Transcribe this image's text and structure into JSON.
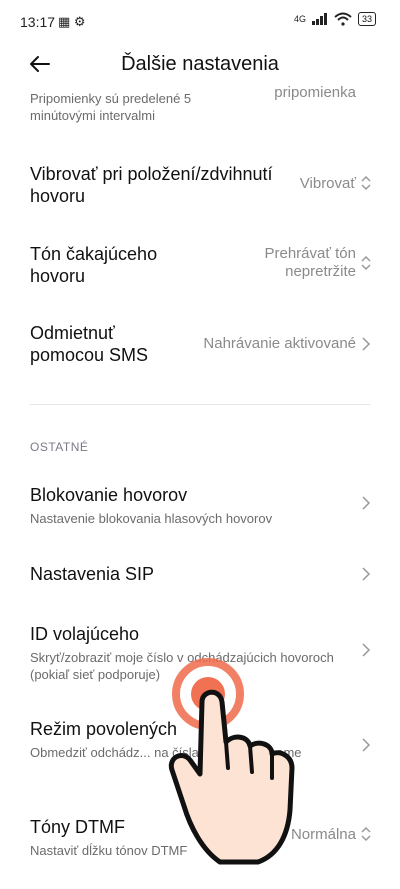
{
  "status_bar": {
    "time": "13:17",
    "battery": "33",
    "network": "4G"
  },
  "header": {
    "title": "Ďalšie nastavenia",
    "back_icon": "back-arrow-icon"
  },
  "top_partial": {
    "subtitle": "Pripomienky sú predelené 5 minútovými intervalmi",
    "value": "pripomienka"
  },
  "rows": [
    {
      "title": "Vibrovať pri položení/zdvihnutí hovoru",
      "value": "Vibrovať",
      "chevron": "up-down-chevron-icon"
    },
    {
      "title": "Tón čakajúceho hovoru",
      "value": "Prehrávať tón nepretržite",
      "chevron": "up-down-chevron-icon"
    },
    {
      "title": "Odmietnuť pomocou SMS",
      "value": "Nahrávanie aktivované",
      "chevron": "chevron-right-icon"
    }
  ],
  "section": {
    "label": "OSTATNÉ"
  },
  "other_rows": [
    {
      "title": "Blokovanie hovorov",
      "subtitle": "Nastavenie blokovania hlasových hovorov",
      "chevron": "chevron-right-icon"
    },
    {
      "title": "Nastavenia SIP",
      "chevron": "chevron-right-icon"
    },
    {
      "title": "ID volajúceho",
      "subtitle": "Skryť/zobraziť moje číslo v odchádzajúcich hovoroch (pokiaľ sieť podporuje)",
      "chevron": "chevron-right-icon"
    },
    {
      "title": "Režim povolených",
      "subtitle": "Obmedziť odchádz... na čísla v tomto zozname",
      "chevron": "chevron-right-icon"
    },
    {
      "title": "Tóny DTMF",
      "subtitle": "Nastaviť dĺžku tónov DTMF",
      "value": "Normálna",
      "chevron": "up-down-chevron-icon"
    }
  ],
  "overlay": {
    "icon": "tap-hand-icon",
    "color": "#f06a4a"
  }
}
